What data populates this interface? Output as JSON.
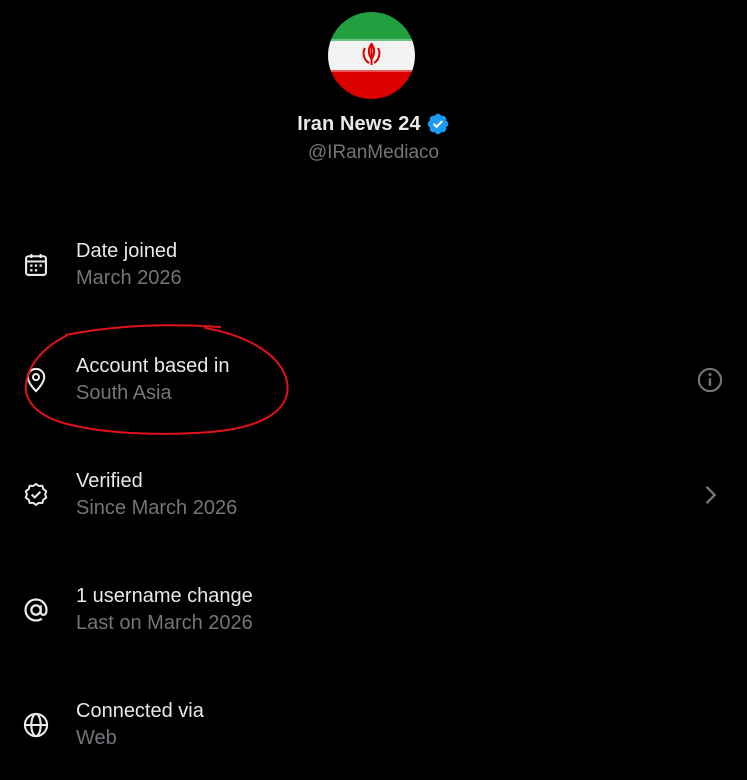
{
  "profile": {
    "display_name": "Iran News 24",
    "handle": "@IRanMediaco",
    "verified": true,
    "avatar": "iran-flag"
  },
  "rows": [
    {
      "title": "Date joined",
      "subtitle": "March 2026",
      "icon": "calendar-icon",
      "trailing": null
    },
    {
      "title": "Account based in",
      "subtitle": "South Asia",
      "icon": "location-pin-icon",
      "trailing": "info-icon"
    },
    {
      "title": "Verified",
      "subtitle": "Since March 2026",
      "icon": "verified-seal-icon",
      "trailing": "chevron-right-icon"
    },
    {
      "title": "1 username change",
      "subtitle": "Last on March 2026",
      "icon": "at-sign-icon",
      "trailing": null
    },
    {
      "title": "Connected via",
      "subtitle": "Web",
      "icon": "globe-icon",
      "trailing": null
    }
  ],
  "colors": {
    "background": "#000000",
    "text_primary": "#e7e9ea",
    "text_secondary": "#71767b",
    "verified_blue": "#1d9bf0",
    "annotation_red": "#e0111b"
  }
}
